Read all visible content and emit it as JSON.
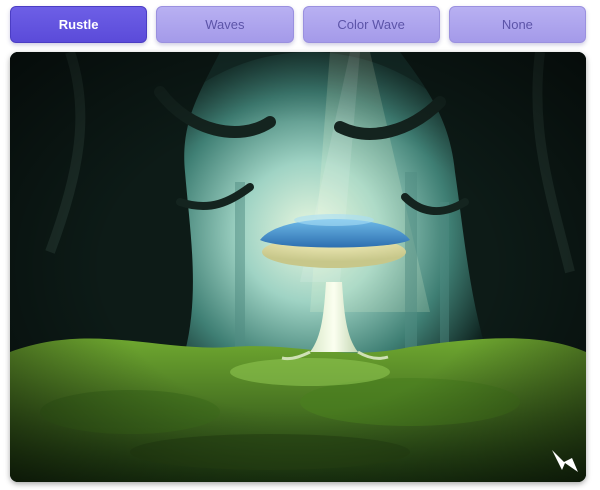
{
  "tabs": [
    {
      "label": "Rustle",
      "active": true
    },
    {
      "label": "Waves",
      "active": false
    },
    {
      "label": "Color Wave",
      "active": false
    },
    {
      "label": "None",
      "active": false
    }
  ],
  "viewer": {
    "image_subject": "mushroom-forest-image",
    "colors": {
      "accent": "#5b4bd9",
      "tab_inactive": "#a49ae9",
      "moss": "#4f8a22",
      "cap": "#3f8fd0"
    }
  }
}
